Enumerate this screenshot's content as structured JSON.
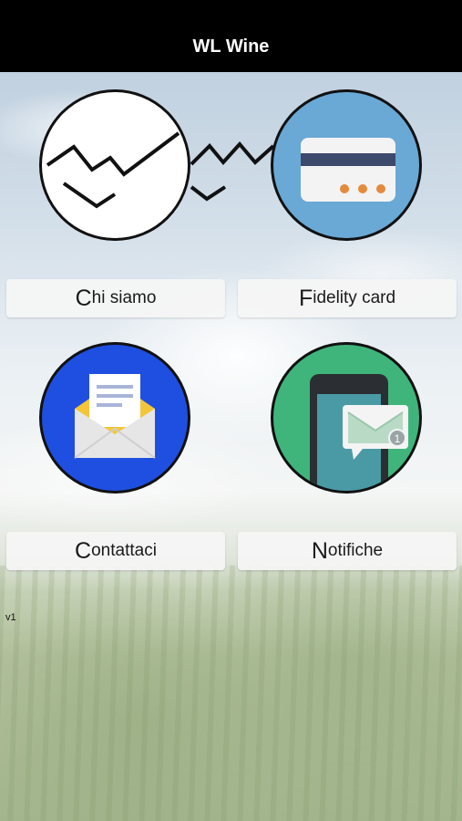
{
  "header": {
    "title": "WL Wine"
  },
  "menu": {
    "chi_siamo": {
      "label_initial": "C",
      "label_rest": "hi siamo"
    },
    "fidelity_card": {
      "label_initial": "F",
      "label_rest": "idelity card"
    },
    "contattaci": {
      "label_initial": "C",
      "label_rest": "ontattaci"
    },
    "notifiche": {
      "label_initial": "N",
      "label_rest": "otifiche"
    }
  },
  "notification_badge": "1",
  "version": "v1",
  "colors": {
    "header_bg": "#000000",
    "card_circle": "#6aa8d6",
    "mail_circle": "#1f4fe0",
    "notif_circle": "#3fb57c"
  }
}
